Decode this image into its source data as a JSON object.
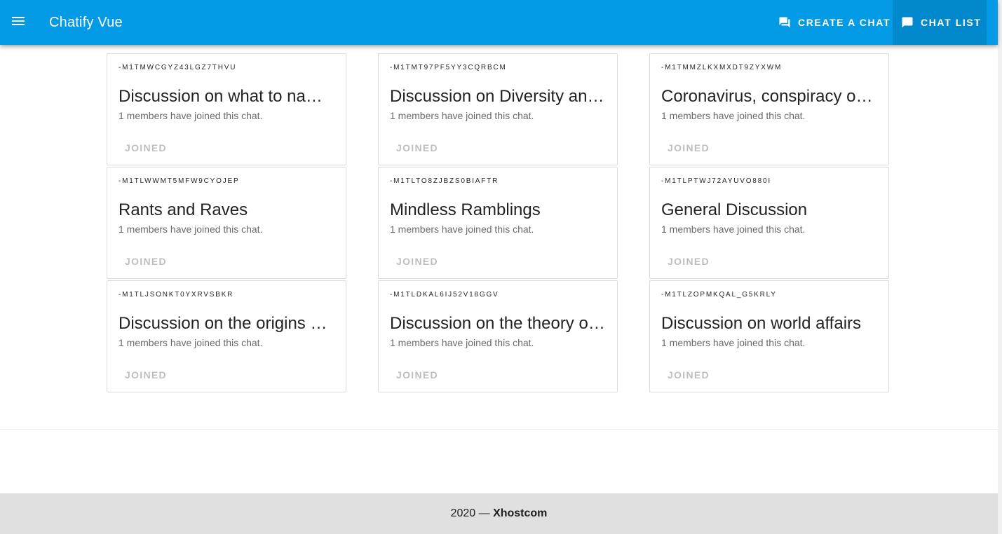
{
  "appbar": {
    "title": "Chatify Vue",
    "menu_icon": "menu-icon",
    "nav": [
      {
        "label": "CREATE A CHAT",
        "icon": "forum-icon"
      },
      {
        "label": "CHAT LIST",
        "icon": "chat-bubble-icon"
      }
    ]
  },
  "chats": [
    {
      "id": "-M1TMWCGYZ43LGZ7THVU",
      "title": "Discussion on what to name…",
      "subtitle": "1 members have joined this chat.",
      "button": "JOINED"
    },
    {
      "id": "-M1TMT97PF5YY3CQRBCM",
      "title": "Discussion on Diversity and…",
      "subtitle": "1 members have joined this chat.",
      "button": "JOINED"
    },
    {
      "id": "-M1TMMZLKXMXDT9ZYXWM",
      "title": "Coronavirus, conspiracy or …",
      "subtitle": "1 members have joined this chat.",
      "button": "JOINED"
    },
    {
      "id": "-M1TLWWMT5MFW9CYOJEP",
      "title": "Rants and Raves",
      "subtitle": "1 members have joined this chat.",
      "button": "JOINED"
    },
    {
      "id": "-M1TLTO8ZJBZS0BIAFTR",
      "title": "Mindless Ramblings",
      "subtitle": "1 members have joined this chat.",
      "button": "JOINED"
    },
    {
      "id": "-M1TLPTWJ72AYUVO880I",
      "title": "General Discussion",
      "subtitle": "1 members have joined this chat.",
      "button": "JOINED"
    },
    {
      "id": "-M1TLJSONKT0YXRVSBKR",
      "title": "Discussion on the origins o…",
      "subtitle": "1 members have joined this chat.",
      "button": "JOINED"
    },
    {
      "id": "-M1TLDKAL6IJ52V18GGV",
      "title": "Discussion on the theory of…",
      "subtitle": "1 members have joined this chat.",
      "button": "JOINED"
    },
    {
      "id": "-M1TLZOPMKQAL_G5KRLY",
      "title": "Discussion on world affairs",
      "subtitle": "1 members have joined this chat.",
      "button": "JOINED"
    }
  ],
  "footer": {
    "year": "2020 — ",
    "brand": "Xhostcom"
  },
  "colors": {
    "appbar": "#039be5",
    "active_nav": "#0288cc",
    "footer": "#e0e0e0"
  }
}
